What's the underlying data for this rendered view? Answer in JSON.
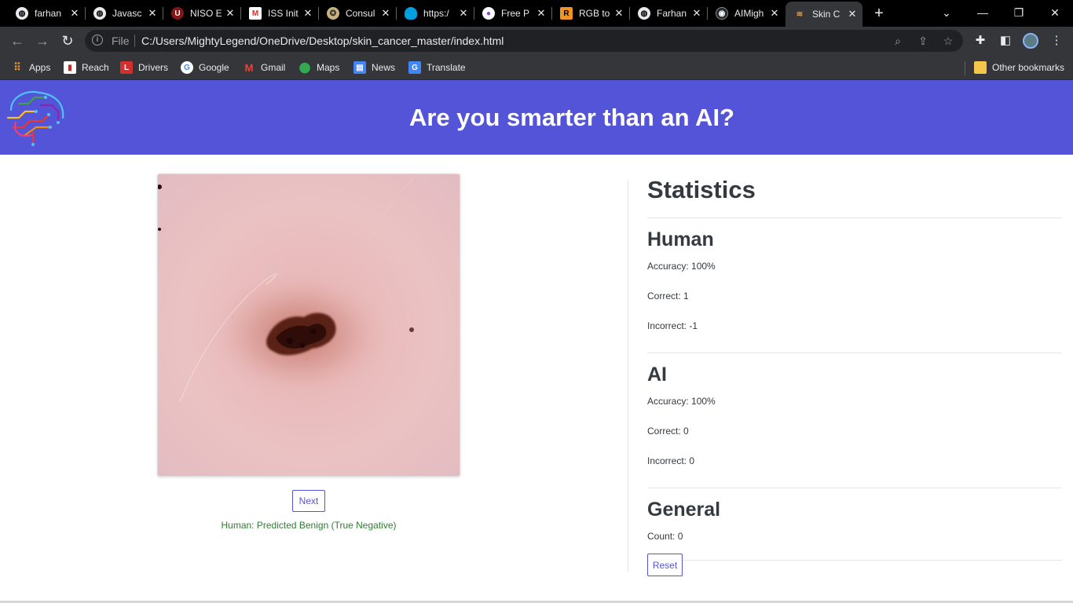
{
  "browser": {
    "tabs": [
      {
        "title": "farhan",
        "icon": "globe-icon"
      },
      {
        "title": "Javasc",
        "icon": "globe-icon"
      },
      {
        "title": "NISO E",
        "icon": "ou-logo-icon"
      },
      {
        "title": "ISS Init",
        "icon": "gmail-icon"
      },
      {
        "title": "Consul",
        "icon": "seal-icon"
      },
      {
        "title": "https:/",
        "icon": "salesforce-cloud-icon"
      },
      {
        "title": "Free P",
        "icon": "avatar-icon"
      },
      {
        "title": "RGB to",
        "icon": "r-logo-icon"
      },
      {
        "title": "Farhan",
        "icon": "globe-icon"
      },
      {
        "title": "AIMigh",
        "icon": "github-icon"
      },
      {
        "title": "Skin C",
        "icon": "brain-icon"
      }
    ],
    "address": {
      "file_label": "File",
      "url": "C:/Users/MightyLegend/OneDrive/Desktop/skin_cancer_master/index.html"
    },
    "bookmarks": [
      {
        "label": "Apps",
        "icon": "apps-grid-icon"
      },
      {
        "label": "Reach",
        "icon": "reach-icon"
      },
      {
        "label": "Drivers",
        "icon": "drivers-icon"
      },
      {
        "label": "Google",
        "icon": "google-icon"
      },
      {
        "label": "Gmail",
        "icon": "gmail-icon"
      },
      {
        "label": "Maps",
        "icon": "maps-pin-icon"
      },
      {
        "label": "News",
        "icon": "news-icon"
      },
      {
        "label": "Translate",
        "icon": "translate-icon"
      }
    ],
    "other_bookmarks": "Other bookmarks"
  },
  "page": {
    "title": "Are you smarter than an AI?",
    "next_label": "Next",
    "result": "Human: Predicted Benign (True Negative)",
    "stats": {
      "heading": "Statistics",
      "human": {
        "heading": "Human",
        "accuracy": "Accuracy: 100%",
        "correct": "Correct: 1",
        "incorrect": "Incorrect: -1"
      },
      "ai": {
        "heading": "AI",
        "accuracy": "Accuracy: 100%",
        "correct": "Correct: 0",
        "incorrect": "Incorrect: 0"
      },
      "general": {
        "heading": "General",
        "count": "Count: 0"
      },
      "reset_label": "Reset"
    }
  },
  "colors": {
    "header_bg": "#5454d9",
    "accent": "#5454d9",
    "result_text": "#2e7d32",
    "chrome_dark": "#35363a"
  }
}
